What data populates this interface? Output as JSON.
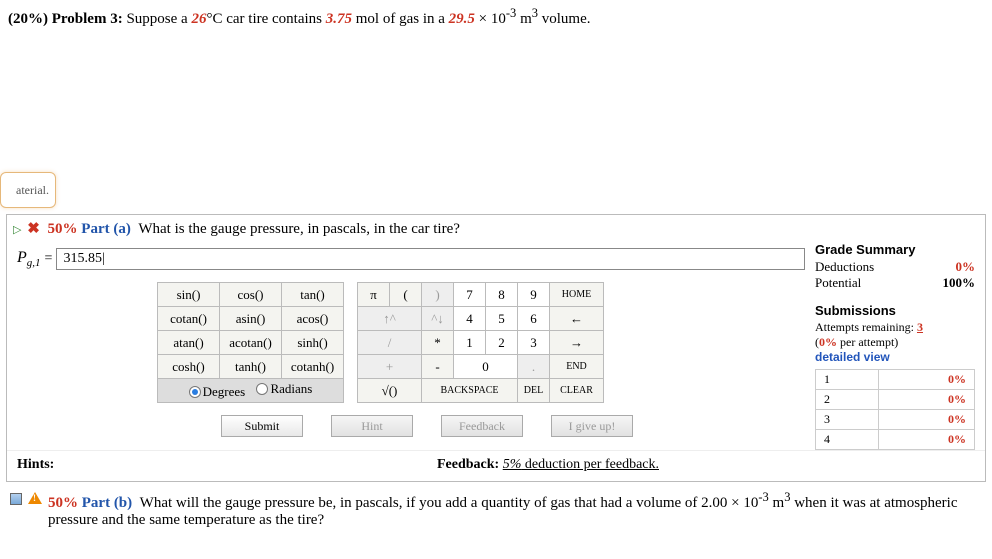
{
  "problem": {
    "weight": "(20%)",
    "label": "Problem 3:",
    "text_pre": "Suppose a ",
    "temp": "26",
    "text_mid1": "°C car tire contains ",
    "mol": "3.75",
    "text_mid2": " mol of gas in a ",
    "vol": "29.5",
    "text_post": " × 10",
    "exp": "-3",
    "unit": " m",
    "exp2": "3",
    "tail": " volume."
  },
  "aterial_label": "aterial.",
  "part_a": {
    "percent": "50%",
    "label": "Part (a)",
    "question": "What is the gauge pressure, in pascals, in the car tire?",
    "var": "P",
    "var_sub": "g,1",
    "eq": " = ",
    "value": "315.85|"
  },
  "calc": {
    "fns": [
      [
        "sin()",
        "cos()",
        "tan()"
      ],
      [
        "cotan()",
        "asin()",
        "acos()"
      ],
      [
        "atan()",
        "acotan()",
        "sinh()"
      ],
      [
        "cosh()",
        "tanh()",
        "cotanh()"
      ]
    ],
    "deg": "Degrees",
    "rad": "Radians",
    "pi": "π",
    "lp": "(",
    "rp": ")",
    "up": "↑^",
    "upd": "^↓",
    "slash": "/",
    "star": "*",
    "plus": "+",
    "minus": "-",
    "sqrt": "√()",
    "nums": {
      "7": "7",
      "8": "8",
      "9": "9",
      "4": "4",
      "5": "5",
      "6": "6",
      "1": "1",
      "2": "2",
      "3": "3",
      "0": "0"
    },
    "dot": ".",
    "home": "HOME",
    "left": "←",
    "right": "→",
    "end": "END",
    "back": "BACKSPACE",
    "del": "DEL",
    "clear": "CLEAR"
  },
  "actions": {
    "submit": "Submit",
    "hint": "Hint",
    "feedback": "Feedback",
    "giveup": "I give up!"
  },
  "hints": {
    "label": "Hints:",
    "fb_label": "Feedback: ",
    "fb_pct": "5%",
    "fb_tail": " deduction per feedback."
  },
  "grade": {
    "title": "Grade Summary",
    "ded_label": "Deductions",
    "ded_val": "0%",
    "pot_label": "Potential",
    "pot_val": "100%",
    "sub_title": "Submissions",
    "att_label": "Attempts remaining: ",
    "att_left": "3",
    "per_attempt": "(0% per attempt)",
    "detail": "detailed view",
    "rows": [
      {
        "n": "1",
        "v": "0%"
      },
      {
        "n": "2",
        "v": "0%"
      },
      {
        "n": "3",
        "v": "0%"
      },
      {
        "n": "4",
        "v": "0%"
      }
    ]
  },
  "part_b": {
    "percent": "50%",
    "label": "Part (b)",
    "q1": "What will the gauge pressure be, in pascals, if you add a quantity of gas that had a volume of 2.00 × 10",
    "exp1": "-3",
    "q2": " m",
    "exp2": "3",
    "q3": " when it was at atmospheric pressure and the same temperature as the tire?"
  }
}
